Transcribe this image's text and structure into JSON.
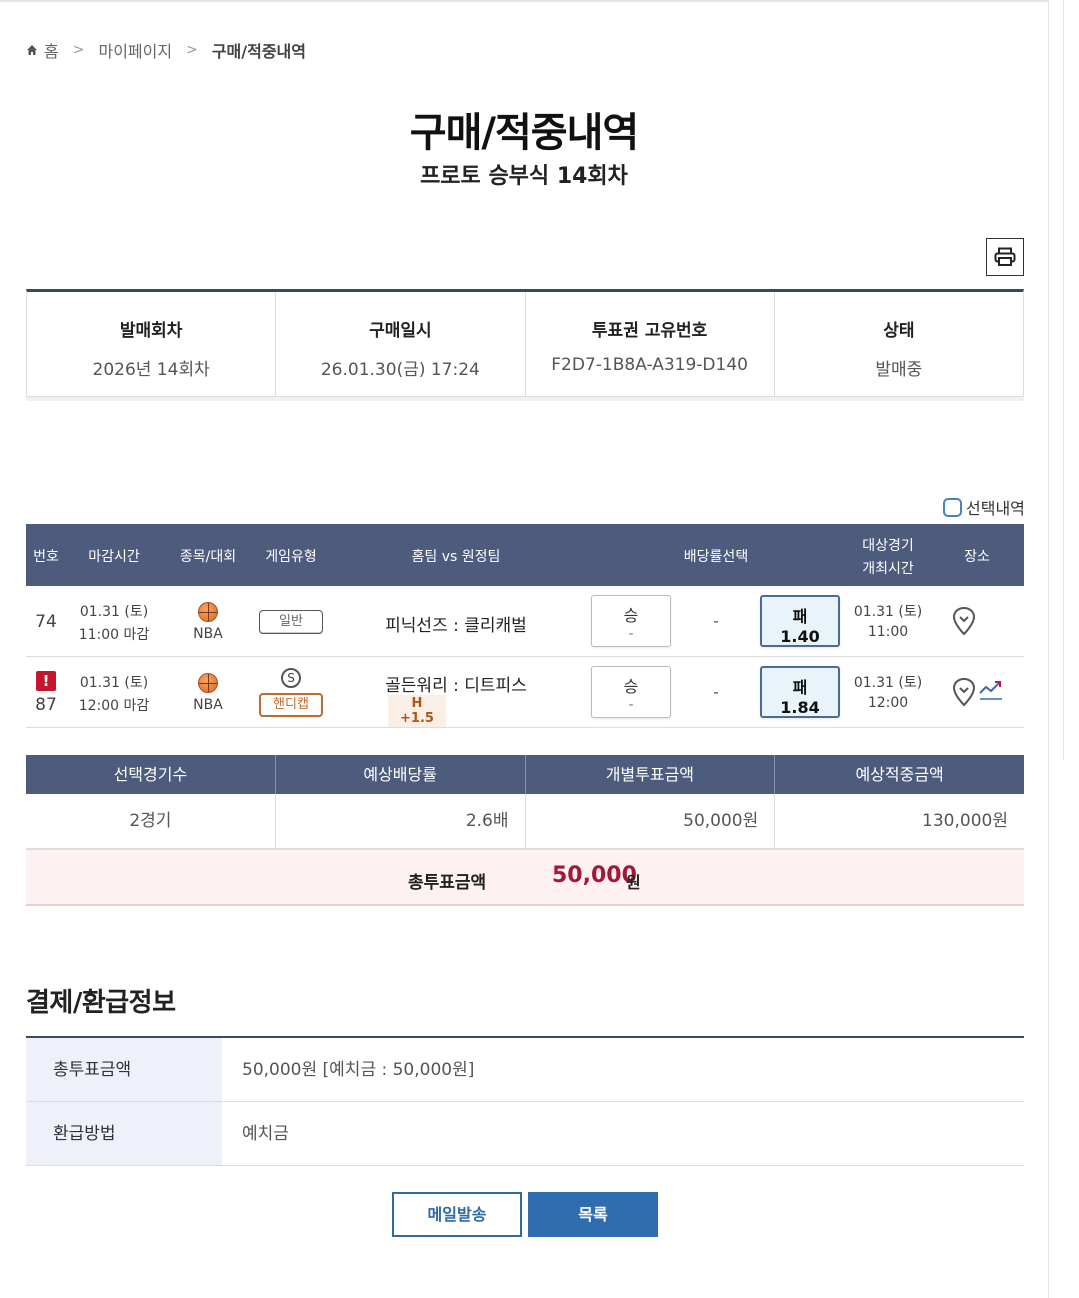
{
  "breadcrumb": {
    "home": "홈",
    "mypage": "마이페이지",
    "current": "구매/적중내역"
  },
  "title": "구매/적중내역",
  "subtitle": "프로토 승부식 14회차",
  "info": [
    {
      "label": "발매회차",
      "value": "2026년 14회차"
    },
    {
      "label": "구매일시",
      "value": "26.01.30(금) 17:24"
    },
    {
      "label": "투표권 고유번호",
      "value": "F2D7-1B8A-A319-D140"
    },
    {
      "label": "상태",
      "value": "발매중"
    }
  ],
  "select_history_label": "선택내역",
  "games_head": {
    "no": "번호",
    "deadline": "마감시간",
    "sport": "종목/대회",
    "type": "게임유형",
    "teams": "홈팀 vs 원정팀",
    "odds": "배당률선택",
    "match_time_1": "대상경기",
    "match_time_2": "개최시간",
    "venue": "장소"
  },
  "games": [
    {
      "no": "74",
      "date": "01.31 (토)",
      "deadline": "11:00 마감",
      "league": "NBA",
      "type": "일반",
      "home": "피닉선즈",
      "away": "클리캐벌",
      "handicap": "",
      "win_label": "승",
      "win_odds": "-",
      "draw": "-",
      "lose_label": "패",
      "lose_odds": "1.40",
      "match_date": "01.31 (토)",
      "match_time": "11:00"
    },
    {
      "no": "87",
      "date": "01.31 (토)",
      "deadline": "12:00 마감",
      "league": "NBA",
      "type": "핸디캡",
      "s_mark": "S",
      "home": "골든워리",
      "away": "디트피스",
      "handicap": "H +1.5",
      "win_label": "승",
      "win_odds": "-",
      "draw": "-",
      "lose_label": "패",
      "lose_odds": "1.84",
      "match_date": "01.31 (토)",
      "match_time": "12:00"
    }
  ],
  "summary": {
    "headers": [
      "선택경기수",
      "예상배당률",
      "개별투표금액",
      "예상적중금액"
    ],
    "values": [
      "2경기",
      "2.6배",
      "50,000원",
      "130,000원"
    ]
  },
  "total": {
    "label": "총투표금액",
    "amount": "50,000",
    "unit": "원"
  },
  "payment": {
    "title": "결제/환급정보",
    "rows": [
      {
        "key": "총투표금액",
        "value": "50,000원 [예치금 : 50,000원]"
      },
      {
        "key": "환급방법",
        "value": "예치금"
      }
    ]
  },
  "buttons": {
    "mail": "메일발송",
    "list": "목록"
  },
  "colors": {
    "header_bg": "#4d5b7c",
    "accent": "#a3173a",
    "primary_btn": "#2f6cb0"
  }
}
